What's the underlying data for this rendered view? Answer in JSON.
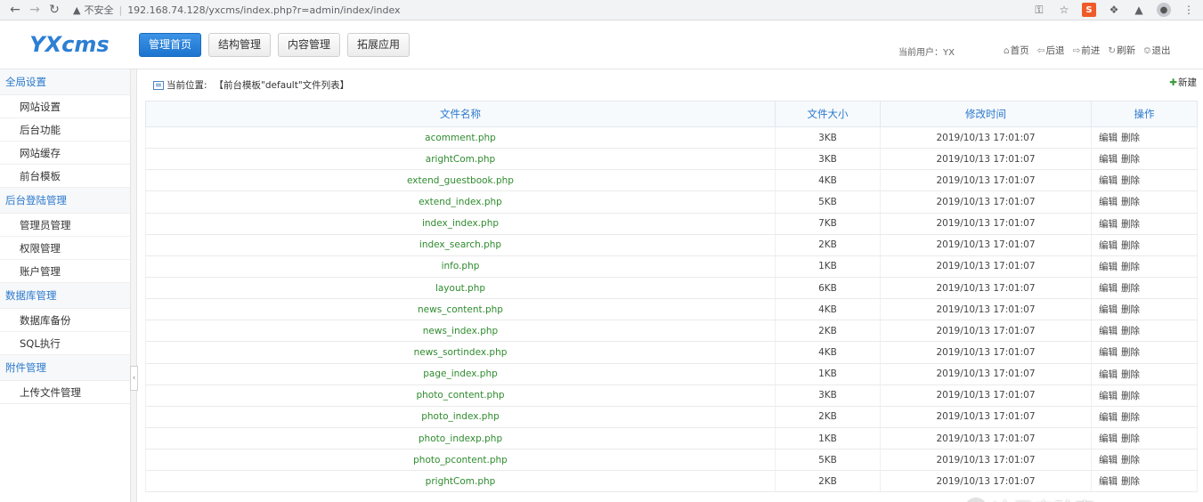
{
  "browser": {
    "security_label": "不安全",
    "url": "192.168.74.128/yxcms/index.php?r=admin/index/index"
  },
  "header": {
    "logo": "YXcms",
    "tabs": [
      {
        "label": "管理首页",
        "active": true
      },
      {
        "label": "结构管理",
        "active": false
      },
      {
        "label": "内容管理",
        "active": false
      },
      {
        "label": "拓展应用",
        "active": false
      }
    ],
    "current_user": "当前用户：YX",
    "links": [
      "首页",
      "后退",
      "前进",
      "刷新",
      "退出"
    ]
  },
  "sidebar": {
    "groups": [
      {
        "title": "全局设置",
        "items": [
          "网站设置",
          "后台功能",
          "网站缓存",
          "前台模板"
        ]
      },
      {
        "title": "后台登陆管理",
        "items": [
          "管理员管理",
          "权限管理",
          "账户管理"
        ]
      },
      {
        "title": "数据库管理",
        "items": [
          "数据库备份",
          "SQL执行"
        ]
      },
      {
        "title": "附件管理",
        "items": [
          "上传文件管理"
        ]
      }
    ]
  },
  "main": {
    "breadcrumb_label": "当前位置:",
    "breadcrumb_path": "【前台模板\"default\"文件列表】",
    "new_label": "新建",
    "columns": [
      "文件名称",
      "文件大小",
      "修改时间",
      "操作"
    ],
    "edit_label": "编辑",
    "delete_label": "删除",
    "rows": [
      {
        "name": "acomment.php",
        "size": "3KB",
        "mtime": "2019/10/13 17:01:07"
      },
      {
        "name": "arightCom.php",
        "size": "3KB",
        "mtime": "2019/10/13 17:01:07"
      },
      {
        "name": "extend_guestbook.php",
        "size": "4KB",
        "mtime": "2019/10/13 17:01:07"
      },
      {
        "name": "extend_index.php",
        "size": "5KB",
        "mtime": "2019/10/13 17:01:07"
      },
      {
        "name": "index_index.php",
        "size": "7KB",
        "mtime": "2019/10/13 17:01:07"
      },
      {
        "name": "index_search.php",
        "size": "2KB",
        "mtime": "2019/10/13 17:01:07"
      },
      {
        "name": "info.php",
        "size": "1KB",
        "mtime": "2019/10/13 17:01:07"
      },
      {
        "name": "layout.php",
        "size": "6KB",
        "mtime": "2019/10/13 17:01:07"
      },
      {
        "name": "news_content.php",
        "size": "4KB",
        "mtime": "2019/10/13 17:01:07"
      },
      {
        "name": "news_index.php",
        "size": "2KB",
        "mtime": "2019/10/13 17:01:07"
      },
      {
        "name": "news_sortindex.php",
        "size": "4KB",
        "mtime": "2019/10/13 17:01:07"
      },
      {
        "name": "page_index.php",
        "size": "1KB",
        "mtime": "2019/10/13 17:01:07"
      },
      {
        "name": "photo_content.php",
        "size": "3KB",
        "mtime": "2019/10/13 17:01:07"
      },
      {
        "name": "photo_index.php",
        "size": "2KB",
        "mtime": "2019/10/13 17:01:07"
      },
      {
        "name": "photo_indexp.php",
        "size": "1KB",
        "mtime": "2019/10/13 17:01:07"
      },
      {
        "name": "photo_pcontent.php",
        "size": "5KB",
        "mtime": "2019/10/13 17:01:07"
      },
      {
        "name": "prightCom.php",
        "size": "2KB",
        "mtime": "2019/10/13 17:01:07"
      }
    ]
  },
  "watermark": "冰蚕实验室"
}
